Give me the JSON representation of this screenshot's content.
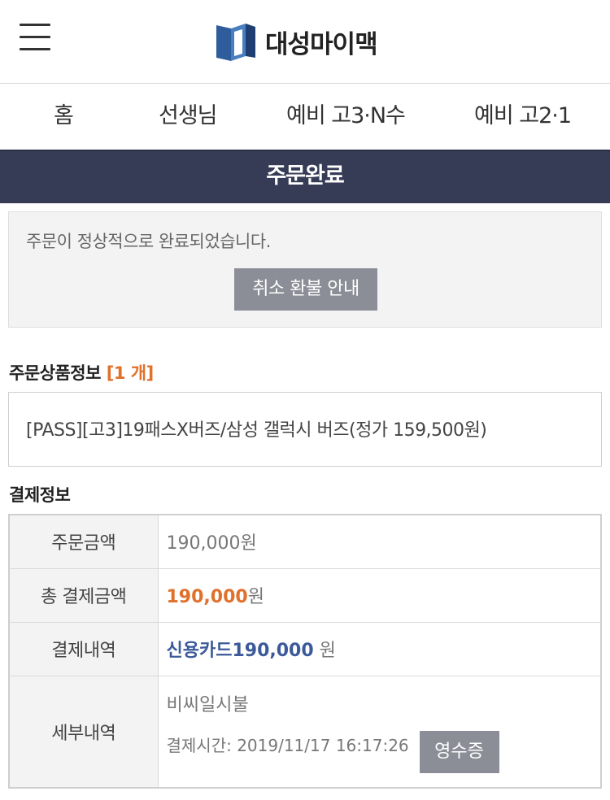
{
  "header": {
    "logo_text": "대성마이맥",
    "menu_icon": "hamburger-menu-icon",
    "logo_icon": "daesung-logo-icon"
  },
  "nav": {
    "items": [
      {
        "label": "홈"
      },
      {
        "label": "선생님"
      },
      {
        "label": "예비 고3·N수"
      },
      {
        "label": "예비 고2·1"
      }
    ]
  },
  "page": {
    "title": "주문완료"
  },
  "notice": {
    "message": "주문이 정상적으로 완료되었습니다.",
    "refund_button": "취소 환불 안내"
  },
  "order_items": {
    "title": "주문상품정보",
    "count": "[1 개]",
    "product": "[PASS][고3]19패스X버즈/삼성 갤럭시 버즈(정가 159,500원)"
  },
  "payment": {
    "title": "결제정보",
    "rows": {
      "order_amount": {
        "label": "주문금액",
        "value": "190,000원"
      },
      "total_amount": {
        "label": "총 결제금액",
        "value": "190,000",
        "unit": "원"
      },
      "history": {
        "label": "결제내역",
        "value": "신용카드190,000",
        "unit": " 원"
      },
      "detail": {
        "label": "세부내역",
        "method": "비씨일시불",
        "time": "결제시간: 2019/11/17 16:17:26",
        "receipt_button": "영수증"
      }
    }
  },
  "colors": {
    "title_bar": "#363c55",
    "accent_orange": "#e0702a",
    "accent_blue": "#3c5a9a",
    "button_gray": "#8c8e97"
  }
}
